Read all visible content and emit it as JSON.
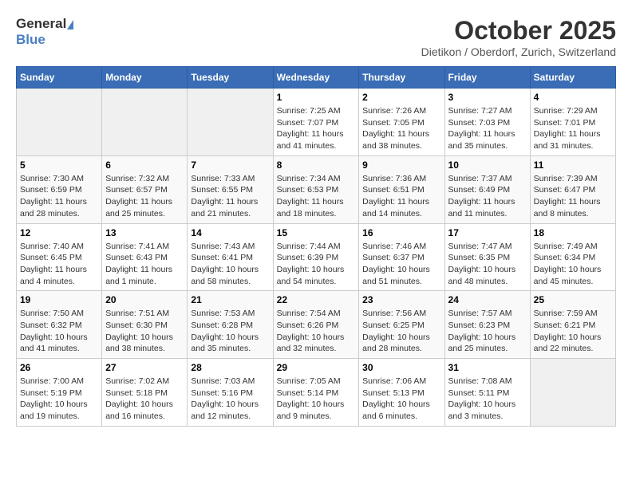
{
  "header": {
    "logo_general": "General",
    "logo_blue": "Blue",
    "month": "October 2025",
    "location": "Dietikon / Oberdorf, Zurich, Switzerland"
  },
  "weekdays": [
    "Sunday",
    "Monday",
    "Tuesday",
    "Wednesday",
    "Thursday",
    "Friday",
    "Saturday"
  ],
  "weeks": [
    [
      {
        "day": "",
        "info": ""
      },
      {
        "day": "",
        "info": ""
      },
      {
        "day": "",
        "info": ""
      },
      {
        "day": "1",
        "info": "Sunrise: 7:25 AM\nSunset: 7:07 PM\nDaylight: 11 hours and 41 minutes."
      },
      {
        "day": "2",
        "info": "Sunrise: 7:26 AM\nSunset: 7:05 PM\nDaylight: 11 hours and 38 minutes."
      },
      {
        "day": "3",
        "info": "Sunrise: 7:27 AM\nSunset: 7:03 PM\nDaylight: 11 hours and 35 minutes."
      },
      {
        "day": "4",
        "info": "Sunrise: 7:29 AM\nSunset: 7:01 PM\nDaylight: 11 hours and 31 minutes."
      }
    ],
    [
      {
        "day": "5",
        "info": "Sunrise: 7:30 AM\nSunset: 6:59 PM\nDaylight: 11 hours and 28 minutes."
      },
      {
        "day": "6",
        "info": "Sunrise: 7:32 AM\nSunset: 6:57 PM\nDaylight: 11 hours and 25 minutes."
      },
      {
        "day": "7",
        "info": "Sunrise: 7:33 AM\nSunset: 6:55 PM\nDaylight: 11 hours and 21 minutes."
      },
      {
        "day": "8",
        "info": "Sunrise: 7:34 AM\nSunset: 6:53 PM\nDaylight: 11 hours and 18 minutes."
      },
      {
        "day": "9",
        "info": "Sunrise: 7:36 AM\nSunset: 6:51 PM\nDaylight: 11 hours and 14 minutes."
      },
      {
        "day": "10",
        "info": "Sunrise: 7:37 AM\nSunset: 6:49 PM\nDaylight: 11 hours and 11 minutes."
      },
      {
        "day": "11",
        "info": "Sunrise: 7:39 AM\nSunset: 6:47 PM\nDaylight: 11 hours and 8 minutes."
      }
    ],
    [
      {
        "day": "12",
        "info": "Sunrise: 7:40 AM\nSunset: 6:45 PM\nDaylight: 11 hours and 4 minutes."
      },
      {
        "day": "13",
        "info": "Sunrise: 7:41 AM\nSunset: 6:43 PM\nDaylight: 11 hours and 1 minute."
      },
      {
        "day": "14",
        "info": "Sunrise: 7:43 AM\nSunset: 6:41 PM\nDaylight: 10 hours and 58 minutes."
      },
      {
        "day": "15",
        "info": "Sunrise: 7:44 AM\nSunset: 6:39 PM\nDaylight: 10 hours and 54 minutes."
      },
      {
        "day": "16",
        "info": "Sunrise: 7:46 AM\nSunset: 6:37 PM\nDaylight: 10 hours and 51 minutes."
      },
      {
        "day": "17",
        "info": "Sunrise: 7:47 AM\nSunset: 6:35 PM\nDaylight: 10 hours and 48 minutes."
      },
      {
        "day": "18",
        "info": "Sunrise: 7:49 AM\nSunset: 6:34 PM\nDaylight: 10 hours and 45 minutes."
      }
    ],
    [
      {
        "day": "19",
        "info": "Sunrise: 7:50 AM\nSunset: 6:32 PM\nDaylight: 10 hours and 41 minutes."
      },
      {
        "day": "20",
        "info": "Sunrise: 7:51 AM\nSunset: 6:30 PM\nDaylight: 10 hours and 38 minutes."
      },
      {
        "day": "21",
        "info": "Sunrise: 7:53 AM\nSunset: 6:28 PM\nDaylight: 10 hours and 35 minutes."
      },
      {
        "day": "22",
        "info": "Sunrise: 7:54 AM\nSunset: 6:26 PM\nDaylight: 10 hours and 32 minutes."
      },
      {
        "day": "23",
        "info": "Sunrise: 7:56 AM\nSunset: 6:25 PM\nDaylight: 10 hours and 28 minutes."
      },
      {
        "day": "24",
        "info": "Sunrise: 7:57 AM\nSunset: 6:23 PM\nDaylight: 10 hours and 25 minutes."
      },
      {
        "day": "25",
        "info": "Sunrise: 7:59 AM\nSunset: 6:21 PM\nDaylight: 10 hours and 22 minutes."
      }
    ],
    [
      {
        "day": "26",
        "info": "Sunrise: 7:00 AM\nSunset: 5:19 PM\nDaylight: 10 hours and 19 minutes."
      },
      {
        "day": "27",
        "info": "Sunrise: 7:02 AM\nSunset: 5:18 PM\nDaylight: 10 hours and 16 minutes."
      },
      {
        "day": "28",
        "info": "Sunrise: 7:03 AM\nSunset: 5:16 PM\nDaylight: 10 hours and 12 minutes."
      },
      {
        "day": "29",
        "info": "Sunrise: 7:05 AM\nSunset: 5:14 PM\nDaylight: 10 hours and 9 minutes."
      },
      {
        "day": "30",
        "info": "Sunrise: 7:06 AM\nSunset: 5:13 PM\nDaylight: 10 hours and 6 minutes."
      },
      {
        "day": "31",
        "info": "Sunrise: 7:08 AM\nSunset: 5:11 PM\nDaylight: 10 hours and 3 minutes."
      },
      {
        "day": "",
        "info": ""
      }
    ]
  ]
}
